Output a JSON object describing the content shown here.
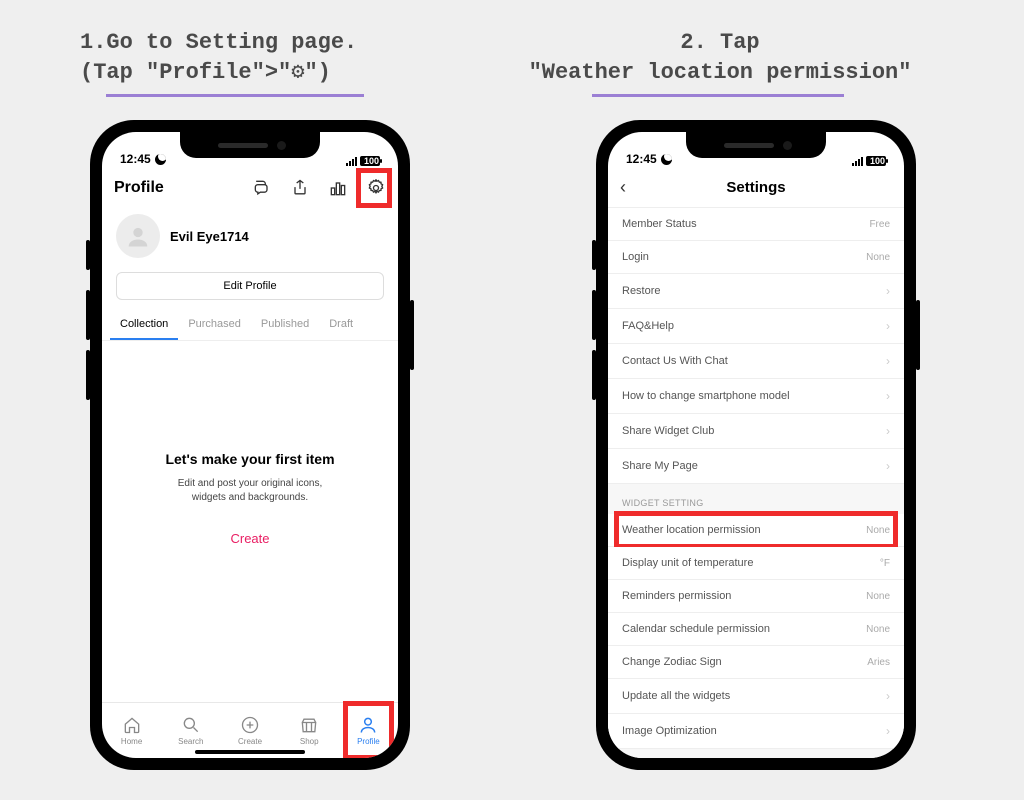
{
  "instructions": {
    "step1_line1": "1.Go to Setting page.",
    "step1_line2": "(Tap \"Profile\">\"⚙\")",
    "step2_line1": "2. Tap",
    "step2_line2": "\"Weather location permission\""
  },
  "status": {
    "time": "12:45",
    "battery": "100"
  },
  "phone1": {
    "header_title": "Profile",
    "username": "Evil Eye1714",
    "edit_button": "Edit Profile",
    "tabs": [
      "Collection",
      "Purchased",
      "Published",
      "Draft"
    ],
    "empty_title": "Let's make your first item",
    "empty_sub1": "Edit and post your original icons,",
    "empty_sub2": "widgets and backgrounds.",
    "create": "Create",
    "nav": [
      "Home",
      "Search",
      "Create",
      "Shop",
      "Profile"
    ]
  },
  "phone2": {
    "title": "Settings",
    "rows": [
      {
        "label": "Member Status",
        "value": "Free"
      },
      {
        "label": "Login",
        "value": "None"
      },
      {
        "label": "Restore",
        "value": "›"
      },
      {
        "label": "FAQ&Help",
        "value": "›"
      },
      {
        "label": "Contact Us With Chat",
        "value": "›"
      },
      {
        "label": "How to change smartphone model",
        "value": "›"
      },
      {
        "label": "Share Widget Club",
        "value": "›"
      },
      {
        "label": "Share My Page",
        "value": "›"
      }
    ],
    "section": "WIDGET SETTING",
    "rows2": [
      {
        "label": "Weather location permission",
        "value": "None"
      },
      {
        "label": "Display unit of temperature",
        "value": "°F"
      },
      {
        "label": "Reminders permission",
        "value": "None"
      },
      {
        "label": "Calendar schedule permission",
        "value": "None"
      },
      {
        "label": "Change Zodiac Sign",
        "value": "Aries"
      },
      {
        "label": "Update all the widgets",
        "value": "›"
      },
      {
        "label": "Image Optimization",
        "value": "›"
      }
    ]
  }
}
